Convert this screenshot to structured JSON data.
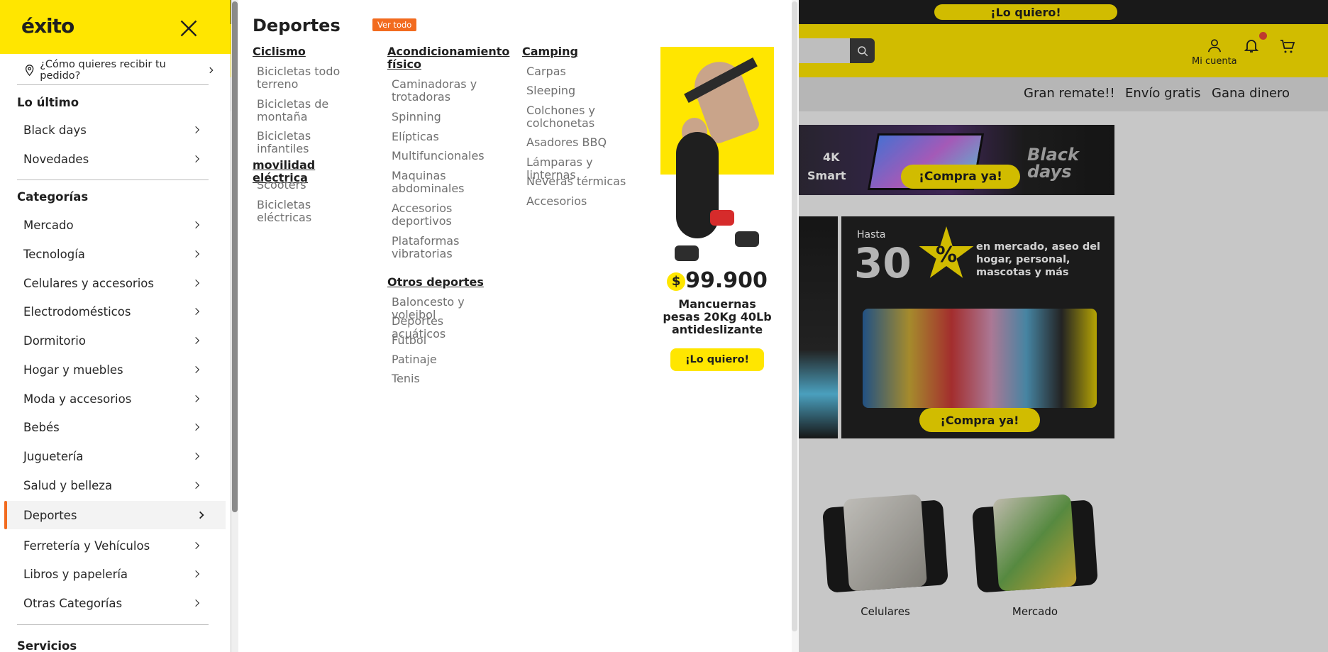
{
  "background": {
    "top_promo_label": "¡Lo quiero!",
    "account_label": "Mi cuenta",
    "subnav": [
      "Gran remate!!",
      "Envío gratis",
      "Gana dinero"
    ],
    "banner1": {
      "tag_4k": "4K",
      "tag_smart": "Smart",
      "cta": "¡Compra ya!",
      "side": "Black days"
    },
    "banner3": {
      "hasta": "Hasta",
      "percent": "30",
      "percent_sign": "%",
      "text": "en mercado, aseo del hogar, personal, mascotas y más",
      "cta": "¡Compra ya!"
    },
    "categories": [
      "Celulares",
      "Mercado"
    ]
  },
  "drawer": {
    "logo_text": "éxito",
    "delivery_prompt": "¿Cómo quieres recibir tu pedido?",
    "sections": {
      "latest": {
        "title": "Lo último",
        "items": [
          "Black days",
          "Novedades"
        ]
      },
      "categories": {
        "title": "Categorías",
        "items": [
          "Mercado",
          "Tecnología",
          "Celulares y accesorios",
          "Electrodomésticos",
          "Dormitorio",
          "Hogar y muebles",
          "Moda y accesorios",
          "Bebés",
          "Juguetería",
          "Salud y belleza",
          "Deportes",
          "Ferretería y Vehículos",
          "Libros y papelería",
          "Otras Categorías"
        ],
        "active": "Deportes"
      },
      "services": {
        "title": "Servicios"
      }
    }
  },
  "mega": {
    "title": "Deportes",
    "view_all": "Ver todo",
    "columns": [
      {
        "groups": [
          {
            "heading": "Ciclismo",
            "links": [
              "Bicicletas todo terreno",
              "Bicicletas de montaña",
              "Bicicletas infantiles"
            ]
          },
          {
            "heading": "movilidad eléctrica",
            "links": [
              "Scooters",
              "Bicicletas eléctricas"
            ]
          }
        ]
      },
      {
        "groups": [
          {
            "heading": "Acondicionamiento físico",
            "links": [
              "Caminadoras y trotadoras",
              "Spinning",
              "Elípticas",
              "Multifuncionales",
              "Maquinas abdominales",
              "Accesorios deportivos",
              "Plataformas vibratorias"
            ]
          },
          {
            "heading": "Otros deportes",
            "links": [
              "Baloncesto y voleibol",
              "Deportes acuáticos",
              "Fútbol",
              "Patinaje",
              "Tenis"
            ]
          }
        ]
      },
      {
        "groups": [
          {
            "heading": "Camping",
            "links": [
              "Carpas",
              "Sleeping",
              "Colchones y colchonetas",
              "Asadores BBQ",
              "Lámparas y linternas",
              "Neveras térmicas",
              "Accesorios"
            ]
          }
        ]
      }
    ],
    "promo": {
      "price_sign": "$",
      "price": "99.900",
      "description": "Mancuernas pesas 20Kg 40Lb antideslizante",
      "cta": "¡Lo quiero!"
    }
  },
  "colors": {
    "brand_yellow": "#ffe600",
    "accent_orange": "#f26b1f"
  }
}
